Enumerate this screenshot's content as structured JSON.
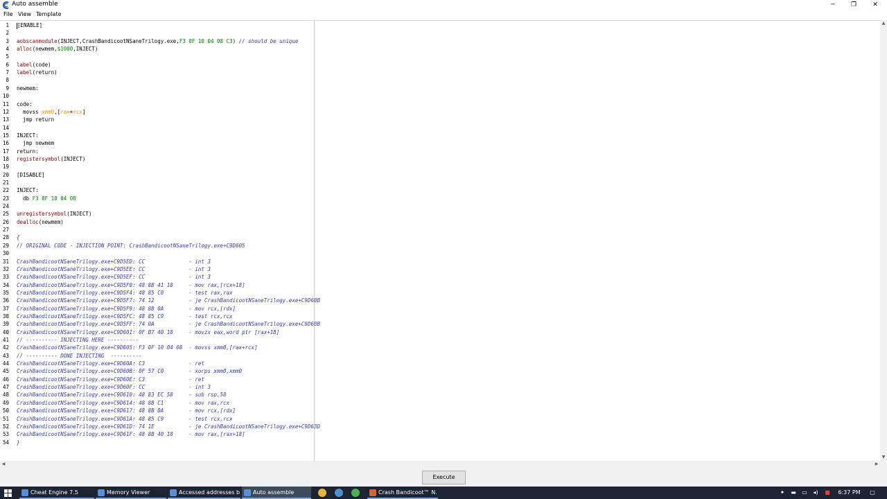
{
  "window": {
    "title": "Auto assemble",
    "minimize": "─",
    "maximize": "❐",
    "close": "✕"
  },
  "menu": {
    "file": "File",
    "view": "View",
    "template": "Template"
  },
  "editor": {
    "lines": [
      {
        "n": "1",
        "tokens": [
          {
            "t": "[ENABLE]",
            "c": "plain"
          }
        ],
        "cursor": true
      },
      {
        "n": "2",
        "tokens": []
      },
      {
        "n": "3",
        "tokens": [
          {
            "t": "aobscanmodule",
            "c": "kw"
          },
          {
            "t": "(INJECT,CrashBandicootNSaneTrilogy.exe,",
            "c": "plain"
          },
          {
            "t": "F3 0F 10 04 08 C3",
            "c": "num"
          },
          {
            "t": ") ",
            "c": "plain"
          },
          {
            "t": "// should be unique",
            "c": "com"
          }
        ]
      },
      {
        "n": "4",
        "tokens": [
          {
            "t": "alloc",
            "c": "kw"
          },
          {
            "t": "(newmem,",
            "c": "plain"
          },
          {
            "t": "$1000",
            "c": "num"
          },
          {
            "t": ",INJECT)",
            "c": "plain"
          }
        ]
      },
      {
        "n": "5",
        "tokens": []
      },
      {
        "n": "6",
        "tokens": [
          {
            "t": "label",
            "c": "kw"
          },
          {
            "t": "(code)",
            "c": "plain"
          }
        ]
      },
      {
        "n": "7",
        "tokens": [
          {
            "t": "label",
            "c": "kw"
          },
          {
            "t": "(return)",
            "c": "plain"
          }
        ]
      },
      {
        "n": "8",
        "tokens": []
      },
      {
        "n": "9",
        "tokens": [
          {
            "t": "newmem:",
            "c": "plain"
          }
        ]
      },
      {
        "n": "10",
        "tokens": []
      },
      {
        "n": "11",
        "tokens": [
          {
            "t": "code:",
            "c": "plain"
          }
        ]
      },
      {
        "n": "12",
        "tokens": [
          {
            "t": "  movss ",
            "c": "plain"
          },
          {
            "t": "xmm0",
            "c": "reg"
          },
          {
            "t": ",[",
            "c": "plain"
          },
          {
            "t": "rax",
            "c": "reg"
          },
          {
            "t": "+",
            "c": "plain"
          },
          {
            "t": "rcx",
            "c": "reg"
          },
          {
            "t": "]",
            "c": "plain"
          }
        ]
      },
      {
        "n": "13",
        "tokens": [
          {
            "t": "  jmp return",
            "c": "plain"
          }
        ]
      },
      {
        "n": "14",
        "tokens": []
      },
      {
        "n": "15",
        "tokens": [
          {
            "t": "INJECT:",
            "c": "plain"
          }
        ]
      },
      {
        "n": "16",
        "tokens": [
          {
            "t": "  jmp newmem",
            "c": "plain"
          }
        ]
      },
      {
        "n": "17",
        "tokens": [
          {
            "t": "return:",
            "c": "plain"
          }
        ]
      },
      {
        "n": "18",
        "tokens": [
          {
            "t": "registersymbol",
            "c": "kw"
          },
          {
            "t": "(INJECT)",
            "c": "plain"
          }
        ]
      },
      {
        "n": "19",
        "tokens": []
      },
      {
        "n": "20",
        "tokens": [
          {
            "t": "[DISABLE]",
            "c": "plain"
          }
        ]
      },
      {
        "n": "21",
        "tokens": []
      },
      {
        "n": "22",
        "tokens": [
          {
            "t": "INJECT:",
            "c": "plain"
          }
        ]
      },
      {
        "n": "23",
        "tokens": [
          {
            "t": "  db ",
            "c": "plain"
          },
          {
            "t": "F3 0F 10 04 08",
            "c": "num"
          }
        ]
      },
      {
        "n": "24",
        "tokens": []
      },
      {
        "n": "25",
        "tokens": [
          {
            "t": "unregistersymbol",
            "c": "kw"
          },
          {
            "t": "(INJECT)",
            "c": "plain"
          }
        ]
      },
      {
        "n": "26",
        "tokens": [
          {
            "t": "dealloc",
            "c": "kw"
          },
          {
            "t": "(newmem)",
            "c": "plain"
          }
        ]
      },
      {
        "n": "27",
        "tokens": []
      },
      {
        "n": "28",
        "tokens": [
          {
            "t": "{",
            "c": "com"
          }
        ]
      },
      {
        "n": "29",
        "tokens": [
          {
            "t": "// ORIGINAL CODE - INJECTION POINT: CrashBandicootNSaneTrilogy.exe+C9D605",
            "c": "com"
          }
        ]
      },
      {
        "n": "30",
        "tokens": []
      },
      {
        "n": "31",
        "tokens": [
          {
            "t": "CrashBandicootNSaneTrilogy.exe+C9D5ED: CC              - int 3",
            "c": "com"
          }
        ]
      },
      {
        "n": "32",
        "tokens": [
          {
            "t": "CrashBandicootNSaneTrilogy.exe+C9D5EE: CC              - int 3",
            "c": "com"
          }
        ]
      },
      {
        "n": "33",
        "tokens": [
          {
            "t": "CrashBandicootNSaneTrilogy.exe+C9D5EF: CC              - int 3",
            "c": "com"
          }
        ]
      },
      {
        "n": "34",
        "tokens": [
          {
            "t": "CrashBandicootNSaneTrilogy.exe+C9D5F0: 48 8B 41 18     - mov rax,[rcx+18]",
            "c": "com"
          }
        ]
      },
      {
        "n": "35",
        "tokens": [
          {
            "t": "CrashBandicootNSaneTrilogy.exe+C9D5F4: 48 85 C0        - test rax,rax",
            "c": "com"
          }
        ]
      },
      {
        "n": "36",
        "tokens": [
          {
            "t": "CrashBandicootNSaneTrilogy.exe+C9D5F7: 74 12           - je CrashBandicootNSaneTrilogy.exe+C9D60B",
            "c": "com"
          }
        ]
      },
      {
        "n": "37",
        "tokens": [
          {
            "t": "CrashBandicootNSaneTrilogy.exe+C9D5F9: 48 8B 0A        - mov rcx,[rdx]",
            "c": "com"
          }
        ]
      },
      {
        "n": "38",
        "tokens": [
          {
            "t": "CrashBandicootNSaneTrilogy.exe+C9D5FC: 48 85 C9        - test rcx,rcx",
            "c": "com"
          }
        ]
      },
      {
        "n": "39",
        "tokens": [
          {
            "t": "CrashBandicootNSaneTrilogy.exe+C9D5FF: 74 0A           - je CrashBandicootNSaneTrilogy.exe+C9D60B",
            "c": "com"
          }
        ]
      },
      {
        "n": "40",
        "tokens": [
          {
            "t": "CrashBandicootNSaneTrilogy.exe+C9D601: 0F B7 40 18     - movzx eax,word ptr [rax+18]",
            "c": "com"
          }
        ]
      },
      {
        "n": "41",
        "tokens": [
          {
            "t": "// ---------- INJECTING HERE ----------",
            "c": "com"
          }
        ]
      },
      {
        "n": "42",
        "tokens": [
          {
            "t": "CrashBandicootNSaneTrilogy.exe+C9D605: F3 0F 10 04 08  - movss xmm0,[rax+rcx]",
            "c": "com"
          }
        ]
      },
      {
        "n": "43",
        "tokens": [
          {
            "t": "// ---------- DONE INJECTING  ----------",
            "c": "com"
          }
        ]
      },
      {
        "n": "44",
        "tokens": [
          {
            "t": "CrashBandicootNSaneTrilogy.exe+C9D60A: C3              - ret",
            "c": "com"
          }
        ]
      },
      {
        "n": "45",
        "tokens": [
          {
            "t": "CrashBandicootNSaneTrilogy.exe+C9D60B: 0F 57 C0        - xorps xmm0,xmm0",
            "c": "com"
          }
        ]
      },
      {
        "n": "46",
        "tokens": [
          {
            "t": "CrashBandicootNSaneTrilogy.exe+C9D60E: C3              - ret",
            "c": "com"
          }
        ]
      },
      {
        "n": "47",
        "tokens": [
          {
            "t": "CrashBandicootNSaneTrilogy.exe+C9D60F: CC              - int 3",
            "c": "com"
          }
        ]
      },
      {
        "n": "48",
        "tokens": [
          {
            "t": "CrashBandicootNSaneTrilogy.exe+C9D610: 48 83 EC 58     - sub rsp,58",
            "c": "com"
          }
        ]
      },
      {
        "n": "49",
        "tokens": [
          {
            "t": "CrashBandicootNSaneTrilogy.exe+C9D614: 48 8B C1        - mov rax,rcx",
            "c": "com"
          }
        ]
      },
      {
        "n": "50",
        "tokens": [
          {
            "t": "CrashBandicootNSaneTrilogy.exe+C9D617: 48 8B 0A        - mov rcx,[rdx]",
            "c": "com"
          }
        ]
      },
      {
        "n": "51",
        "tokens": [
          {
            "t": "CrashBandicootNSaneTrilogy.exe+C9D61A: 48 85 C9        - test rcx,rcx",
            "c": "com"
          }
        ]
      },
      {
        "n": "52",
        "tokens": [
          {
            "t": "CrashBandicootNSaneTrilogy.exe+C9D61D: 74 1E           - je CrashBandicootNSaneTrilogy.exe+C9D63D",
            "c": "com"
          }
        ]
      },
      {
        "n": "53",
        "tokens": [
          {
            "t": "CrashBandicootNSaneTrilogy.exe+C9D61F: 48 8B 40 18     - mov rax,[rax+18]",
            "c": "com"
          }
        ]
      },
      {
        "n": "54",
        "tokens": [
          {
            "t": "}",
            "c": "com"
          }
        ]
      }
    ]
  },
  "execute": {
    "label": "Execute"
  },
  "taskbar": {
    "tasks": [
      {
        "label": "Cheat Engine 7.5",
        "icon": "cheat-engine-icon",
        "color": "#5a8fd6"
      },
      {
        "label": "Memory Viewer",
        "icon": "memory-viewer-icon",
        "color": "#5a8fd6"
      },
      {
        "label": "Accessed addresses b...",
        "icon": "accessed-addresses-icon",
        "color": "#5a8fd6"
      },
      {
        "label": "Auto assemble",
        "icon": "auto-assemble-icon",
        "color": "#5a8fd6"
      },
      {
        "label": "Crash Bandicoot™ N. ...",
        "icon": "crash-bandicoot-icon",
        "color": "#e0622a"
      }
    ],
    "pins": [
      {
        "name": "chrome-icon",
        "color": "#e8b43a"
      },
      {
        "name": "steam-icon",
        "color": "#4a8fd0"
      },
      {
        "name": "game-icon",
        "color": "#4caf50"
      }
    ],
    "clock": "6:37 PM"
  },
  "colors": {
    "keyword": "#8b0000",
    "register": "#ff8c00",
    "number": "#008000",
    "comment": "#3a3aaa",
    "taskbar": "#1c2433"
  }
}
